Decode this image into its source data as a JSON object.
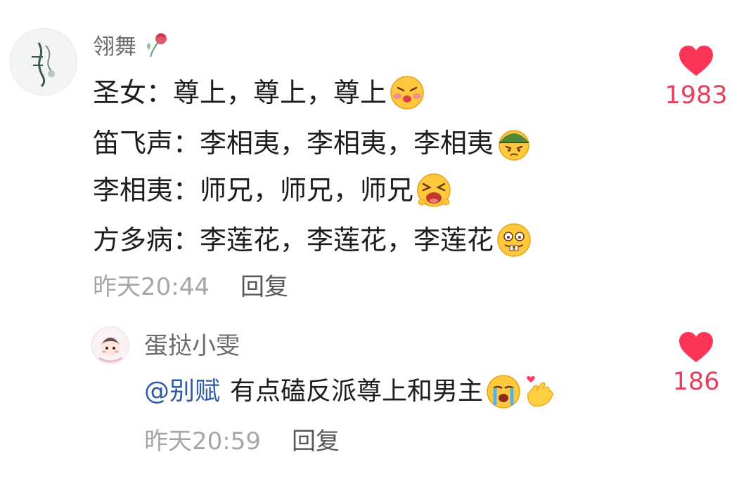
{
  "comment": {
    "author": "翎舞",
    "lines": [
      "圣女：尊上，尊上，尊上",
      "笛飞声：李相夷，李相夷，李相夷",
      "李相夷：师兄，师兄，师兄",
      "方多病：李莲花，李莲花，李莲花"
    ],
    "time": "昨天20:44",
    "reply_label": "回复",
    "likes": "1983"
  },
  "reply": {
    "author": "蛋挞小雯",
    "mention": "@别赋",
    "text": "有点磕反派尊上和男主",
    "time": "昨天20:59",
    "reply_label": "回复",
    "likes": "186"
  },
  "colors": {
    "like": "#e5405e",
    "mention": "#2f5aa8",
    "meta": "#a6a6a6"
  },
  "icons": [
    "rose-icon",
    "kiss-emoji-icon",
    "soldier-emoji-icon",
    "crying-loud-emoji-icon",
    "buckteeth-emoji-icon",
    "sob-emoji-icon",
    "finger-heart-icon",
    "heart-like-icon"
  ]
}
